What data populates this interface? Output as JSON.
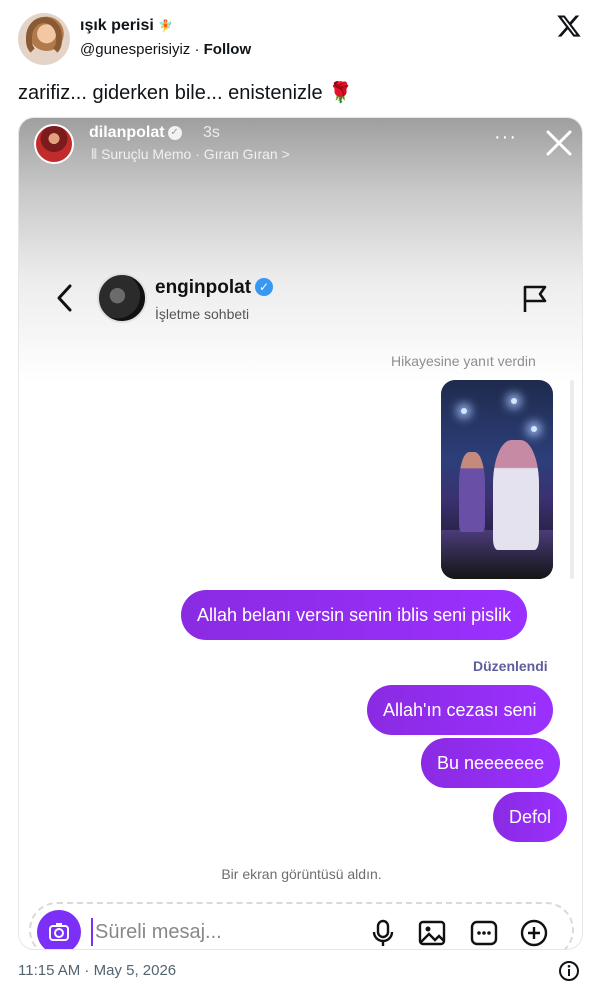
{
  "tweet": {
    "display_name": "ışık perisi",
    "name_emoji": "🧚",
    "handle": "@gunesperisiyiz",
    "separator": "·",
    "follow_label": "Follow",
    "text": "zarifiz... giderken bile... enistenizle",
    "text_emoji": "🌹",
    "timestamp": "11:15 AM · May 5, 2026",
    "logo_icon": "x-logo-icon",
    "info_icon": "info-icon"
  },
  "story": {
    "username": "dilanpolat",
    "time": "3s",
    "music": "Suruçlu Memo · Gıran Gıran >",
    "menu_glyph": "···"
  },
  "chat": {
    "contact_name": "enginpolat",
    "contact_subtitle": "İşletme sohbeti",
    "reply_label": "Hikayesine yanıt verdin",
    "messages": [
      {
        "text": "Allah belanı versin senin iblis seni pislik"
      },
      {
        "text": "Allah'ın cezası seni"
      },
      {
        "text": "Bu neeeeeee"
      },
      {
        "text": "Defol"
      }
    ],
    "edited_label": "Düzenlendi",
    "system_note": "Bir ekran görüntüsü aldın.",
    "composer_placeholder": "Süreli mesaj..."
  },
  "colors": {
    "bubble": "#8a2be2",
    "verified": "#3897f0",
    "camera": "#7b2ff7"
  }
}
